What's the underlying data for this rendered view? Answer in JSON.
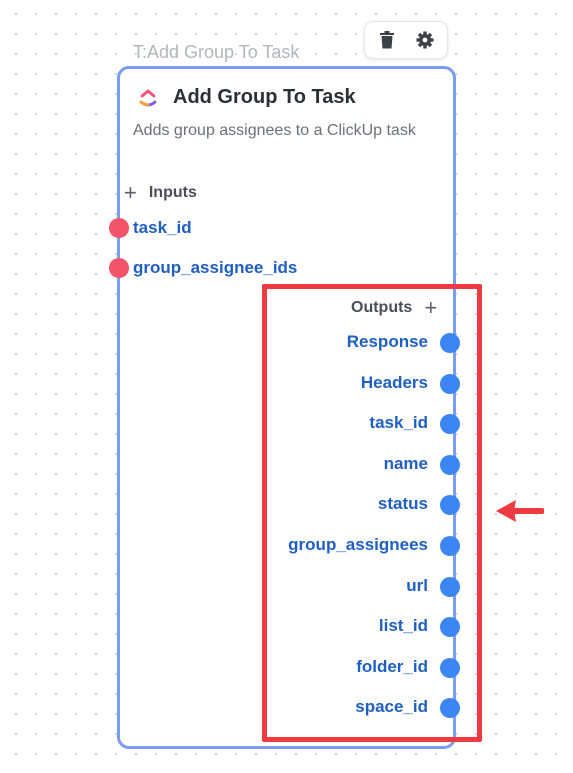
{
  "node": {
    "ghost_title": "T:Add Group To Task",
    "title": "Add Group To Task",
    "description": "Adds group assignees to a ClickUp task",
    "logo_icon": "clickup-logo-icon"
  },
  "toolbar": {
    "delete_icon": "trash-icon",
    "settings_icon": "gear-icon"
  },
  "inputs": {
    "label": "Inputs",
    "add_symbol": "+",
    "ports": [
      {
        "label": "task_id"
      },
      {
        "label": "group_assignee_ids"
      }
    ]
  },
  "outputs": {
    "label": "Outputs",
    "add_symbol": "+",
    "ports": [
      {
        "label": "Response"
      },
      {
        "label": "Headers"
      },
      {
        "label": "task_id"
      },
      {
        "label": "name"
      },
      {
        "label": "status"
      },
      {
        "label": "group_assignees"
      },
      {
        "label": "url"
      },
      {
        "label": "list_id"
      },
      {
        "label": "folder_id"
      },
      {
        "label": "space_id"
      }
    ]
  },
  "colors": {
    "node_border": "#7b9cf0",
    "input_port": "#f2546a",
    "output_port": "#3c86f3",
    "port_label": "#1f5fc1",
    "highlight": "#ee3b42"
  }
}
